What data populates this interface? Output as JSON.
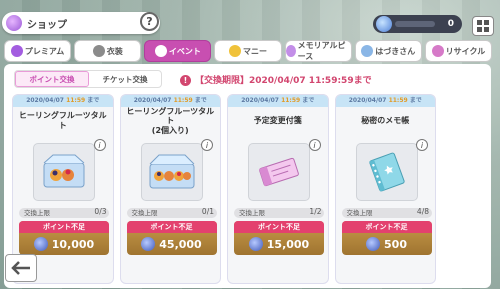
{
  "header": {
    "title": "ショップ",
    "gem_count": "0"
  },
  "tabs": [
    {
      "label": "プレミアム",
      "icon": "premium-icon",
      "color": "#a35de0"
    },
    {
      "label": "衣装",
      "icon": "costume-icon",
      "color": "#8b8b8b"
    },
    {
      "label": "イベント",
      "icon": "event-icon",
      "color": "#ffffff"
    },
    {
      "label": "マニー",
      "icon": "money-icon",
      "color": "#f0c23a"
    },
    {
      "label": "メモリアルピース",
      "icon": "memorial-piece-icon",
      "color": "#c38ee8"
    },
    {
      "label": "はづきさん",
      "icon": "hazuki-icon",
      "color": "#8ab6e6"
    },
    {
      "label": "リサイクル",
      "icon": "recycle-icon",
      "color": "#d67ac8"
    }
  ],
  "subtabs": [
    {
      "label": "ポイント交換"
    },
    {
      "label": "チケット交換"
    }
  ],
  "period": {
    "text": "【交換期限】2020/04/07 11:59:59まで"
  },
  "cards": [
    {
      "date_prefix": "2020/04/07",
      "time": "11:59",
      "date_suffix": "まで",
      "name": "ヒーリングフルーツタルト",
      "limit_label": "交換上限",
      "count": "0/3",
      "ng_label": "ポイント不足",
      "price": "10,000",
      "icon": "fruit-tart-icon"
    },
    {
      "date_prefix": "2020/04/07",
      "time": "11:59",
      "date_suffix": "まで",
      "name": "ヒーリングフルーツタルト\n(2個入り)",
      "limit_label": "交換上限",
      "count": "0/1",
      "ng_label": "ポイント不足",
      "price": "45,000",
      "icon": "fruit-tart-double-icon"
    },
    {
      "date_prefix": "2020/04/07",
      "time": "11:59",
      "date_suffix": "まで",
      "name": "予定変更付箋",
      "limit_label": "交換上限",
      "count": "1/2",
      "ng_label": "ポイント不足",
      "price": "15,000",
      "icon": "sticky-note-icon"
    },
    {
      "date_prefix": "2020/04/07",
      "time": "11:59",
      "date_suffix": "まで",
      "name": "秘密のメモ帳",
      "limit_label": "交換上限",
      "count": "4/8",
      "ng_label": "ポイント不足",
      "price": "500",
      "icon": "memo-notebook-icon"
    }
  ]
}
